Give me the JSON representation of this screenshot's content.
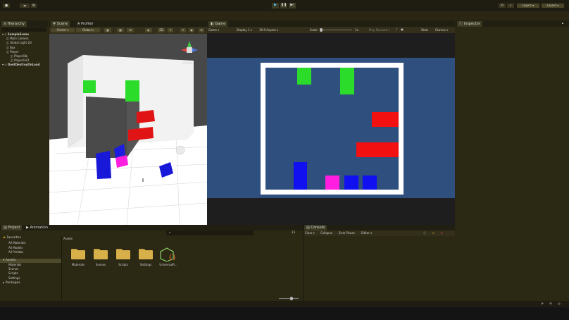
{
  "toolbar": {
    "account_icon": "cloud-icon",
    "layers_label": "Layers",
    "layout_label": "Layout"
  },
  "hierarchy": {
    "tab_label": "Hierarchy",
    "items": [
      {
        "label": "SampleScene",
        "indent": 0,
        "bold": true
      },
      {
        "label": "Main Camera",
        "indent": 1
      },
      {
        "label": "Global Light 2D",
        "indent": 1
      },
      {
        "label": "Box",
        "indent": 1
      },
      {
        "label": "Player",
        "indent": 1
      },
      {
        "label": "PlayerObj",
        "indent": 2
      },
      {
        "label": "PlayerGrid",
        "indent": 2
      },
      {
        "label": "DontDestroyOnLoad",
        "indent": 0,
        "bold": true
      }
    ]
  },
  "scene": {
    "tab_label": "Scene",
    "profiler_tab": "Profiler",
    "center_label": "Center",
    "global_label": "Global",
    "persp_label": "<Persp"
  },
  "game": {
    "tab_label": "Game",
    "game_dropdown": "Game",
    "display_dropdown": "Display 1",
    "aspect_dropdown": "16:9 Aspect",
    "scale_label": "Scale",
    "scale_value": "1x",
    "play_focused": "Play Focused",
    "stats_label": "Stats",
    "gizmos_label": "Gizmos"
  },
  "inspector": {
    "tab_label": "Inspector"
  },
  "project": {
    "tab_label": "Project",
    "animation_tab": "Animation",
    "favorites": "Favorites",
    "fav_items": [
      "All Materials",
      "All Models",
      "All Prefabs"
    ],
    "assets_label": "Assets",
    "asset_tree": [
      "Materials",
      "Scenes",
      "Scripts",
      "Settings"
    ],
    "packages_label": "Packages",
    "breadcrumb": "Assets",
    "count_badge": "23",
    "grid_items": [
      {
        "label": "Materials",
        "type": "folder"
      },
      {
        "label": "Scenes",
        "type": "folder"
      },
      {
        "label": "Scripts",
        "type": "folder"
      },
      {
        "label": "Settings",
        "type": "folder"
      },
      {
        "label": "UniversalR...",
        "type": "asset"
      }
    ]
  },
  "console": {
    "tab_label": "Console",
    "clear": "Clear",
    "collapse": "Collapse",
    "error_pause": "Error Pause",
    "editor": "Editor"
  },
  "colors": {
    "game_bg": "#2f4f7f",
    "green": "#2bdc2b",
    "red": "#f21010",
    "blue": "#1010f0",
    "magenta": "#ff1ee0",
    "white": "#ffffff"
  }
}
